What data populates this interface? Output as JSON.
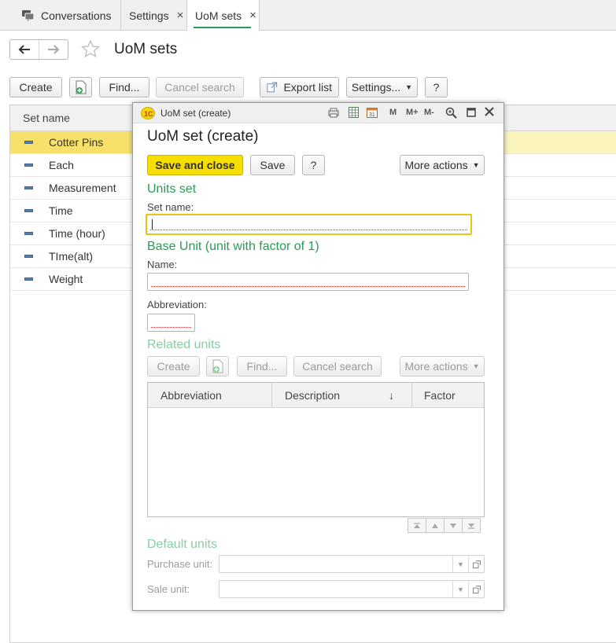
{
  "tabs": [
    {
      "label": "Conversations",
      "icon": "conversations-icon"
    },
    {
      "label": "Settings",
      "close": "×"
    },
    {
      "label": "UoM sets",
      "close": "×",
      "active": true
    }
  ],
  "page": {
    "title": "UoM sets"
  },
  "toolbar": {
    "create": "Create",
    "find": "Find...",
    "cancel_search": "Cancel search",
    "export_list": "Export list",
    "settings": "Settings...",
    "help": "?"
  },
  "list": {
    "header": "Set name",
    "rows": [
      "Cotter Pins",
      "Each",
      "Measurement",
      "Time",
      "Time (hour)",
      "TIme(alt)",
      "Weight"
    ]
  },
  "dialog": {
    "window_title": "UoM set (create)",
    "title_icons": [
      "M",
      "M+",
      "M-"
    ],
    "heading": "UoM set (create)",
    "save_close": "Save and close",
    "save": "Save",
    "help": "?",
    "more_actions": "More actions",
    "units_set": {
      "section": "Units set",
      "set_name_label": "Set name:",
      "set_name_value": ""
    },
    "base_unit": {
      "section": "Base Unit (unit with factor of 1)",
      "name_label": "Name:",
      "name_value": "",
      "abbr_label": "Abbreviation:",
      "abbr_value": ""
    },
    "related": {
      "section": "Related units",
      "create": "Create",
      "find": "Find...",
      "cancel_search": "Cancel search",
      "more_actions": "More actions",
      "columns": [
        "Abbreviation",
        "Description",
        "Factor"
      ],
      "sort_indicator": "↓"
    },
    "defaults": {
      "section": "Default units",
      "purchase_label": "Purchase unit:",
      "sale_label": "Sale unit:"
    }
  },
  "colors": {
    "accent_green": "#2b9a55",
    "selection_yellow": "#f7e16a",
    "primary_button": "#f6de00",
    "focus_border": "#e7c515"
  }
}
